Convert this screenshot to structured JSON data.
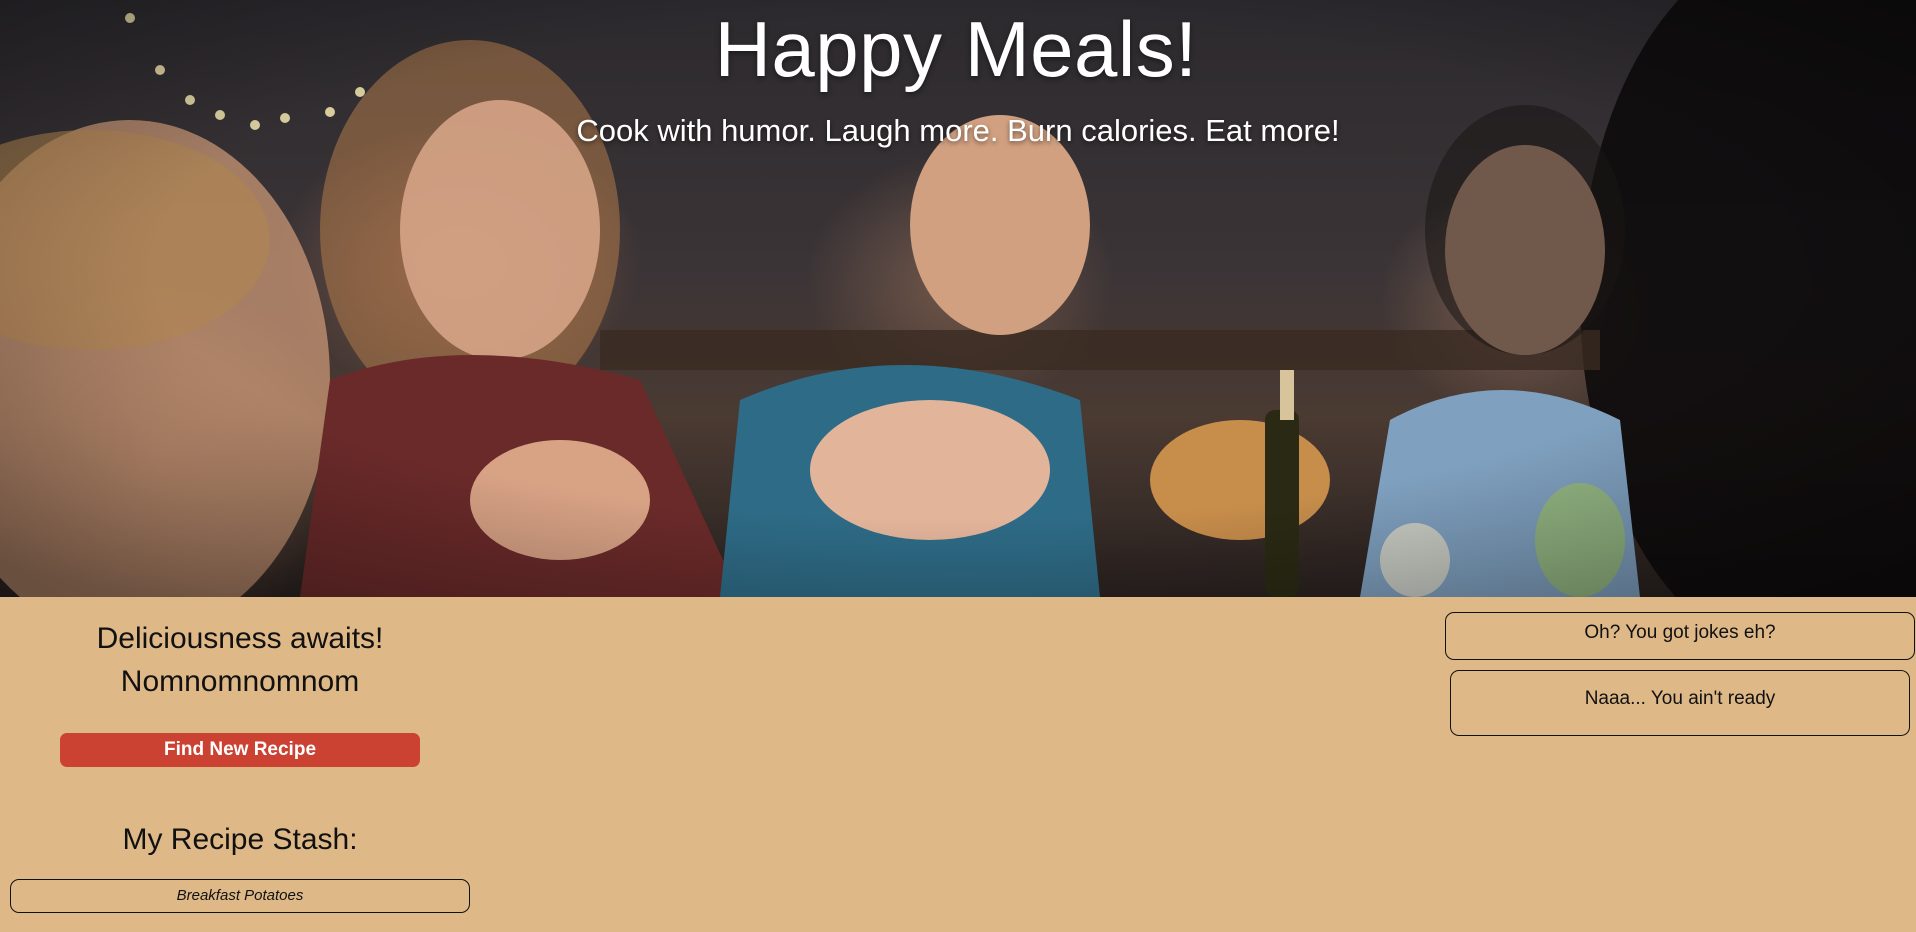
{
  "hero": {
    "title": "Happy Meals!",
    "subtitle": "Cook with humor. Laugh more. Burn calories. Eat more!",
    "image_description": "photo-friends-laughing-at-dinner-table"
  },
  "intro": {
    "line1": "Deliciousness awaits!",
    "line2": "Nomnomnomnom"
  },
  "actions": {
    "find_recipe_label": "Find New Recipe"
  },
  "stash": {
    "title": "My Recipe Stash:",
    "items": [
      "Breakfast Potatoes"
    ]
  },
  "jokes": {
    "question": "Oh? You got jokes eh?",
    "answer": "Naaa... You ain't ready"
  },
  "colors": {
    "page_background": "#deb887",
    "button_background": "#cc4232",
    "button_text": "#ffffff",
    "border": "#111111"
  }
}
